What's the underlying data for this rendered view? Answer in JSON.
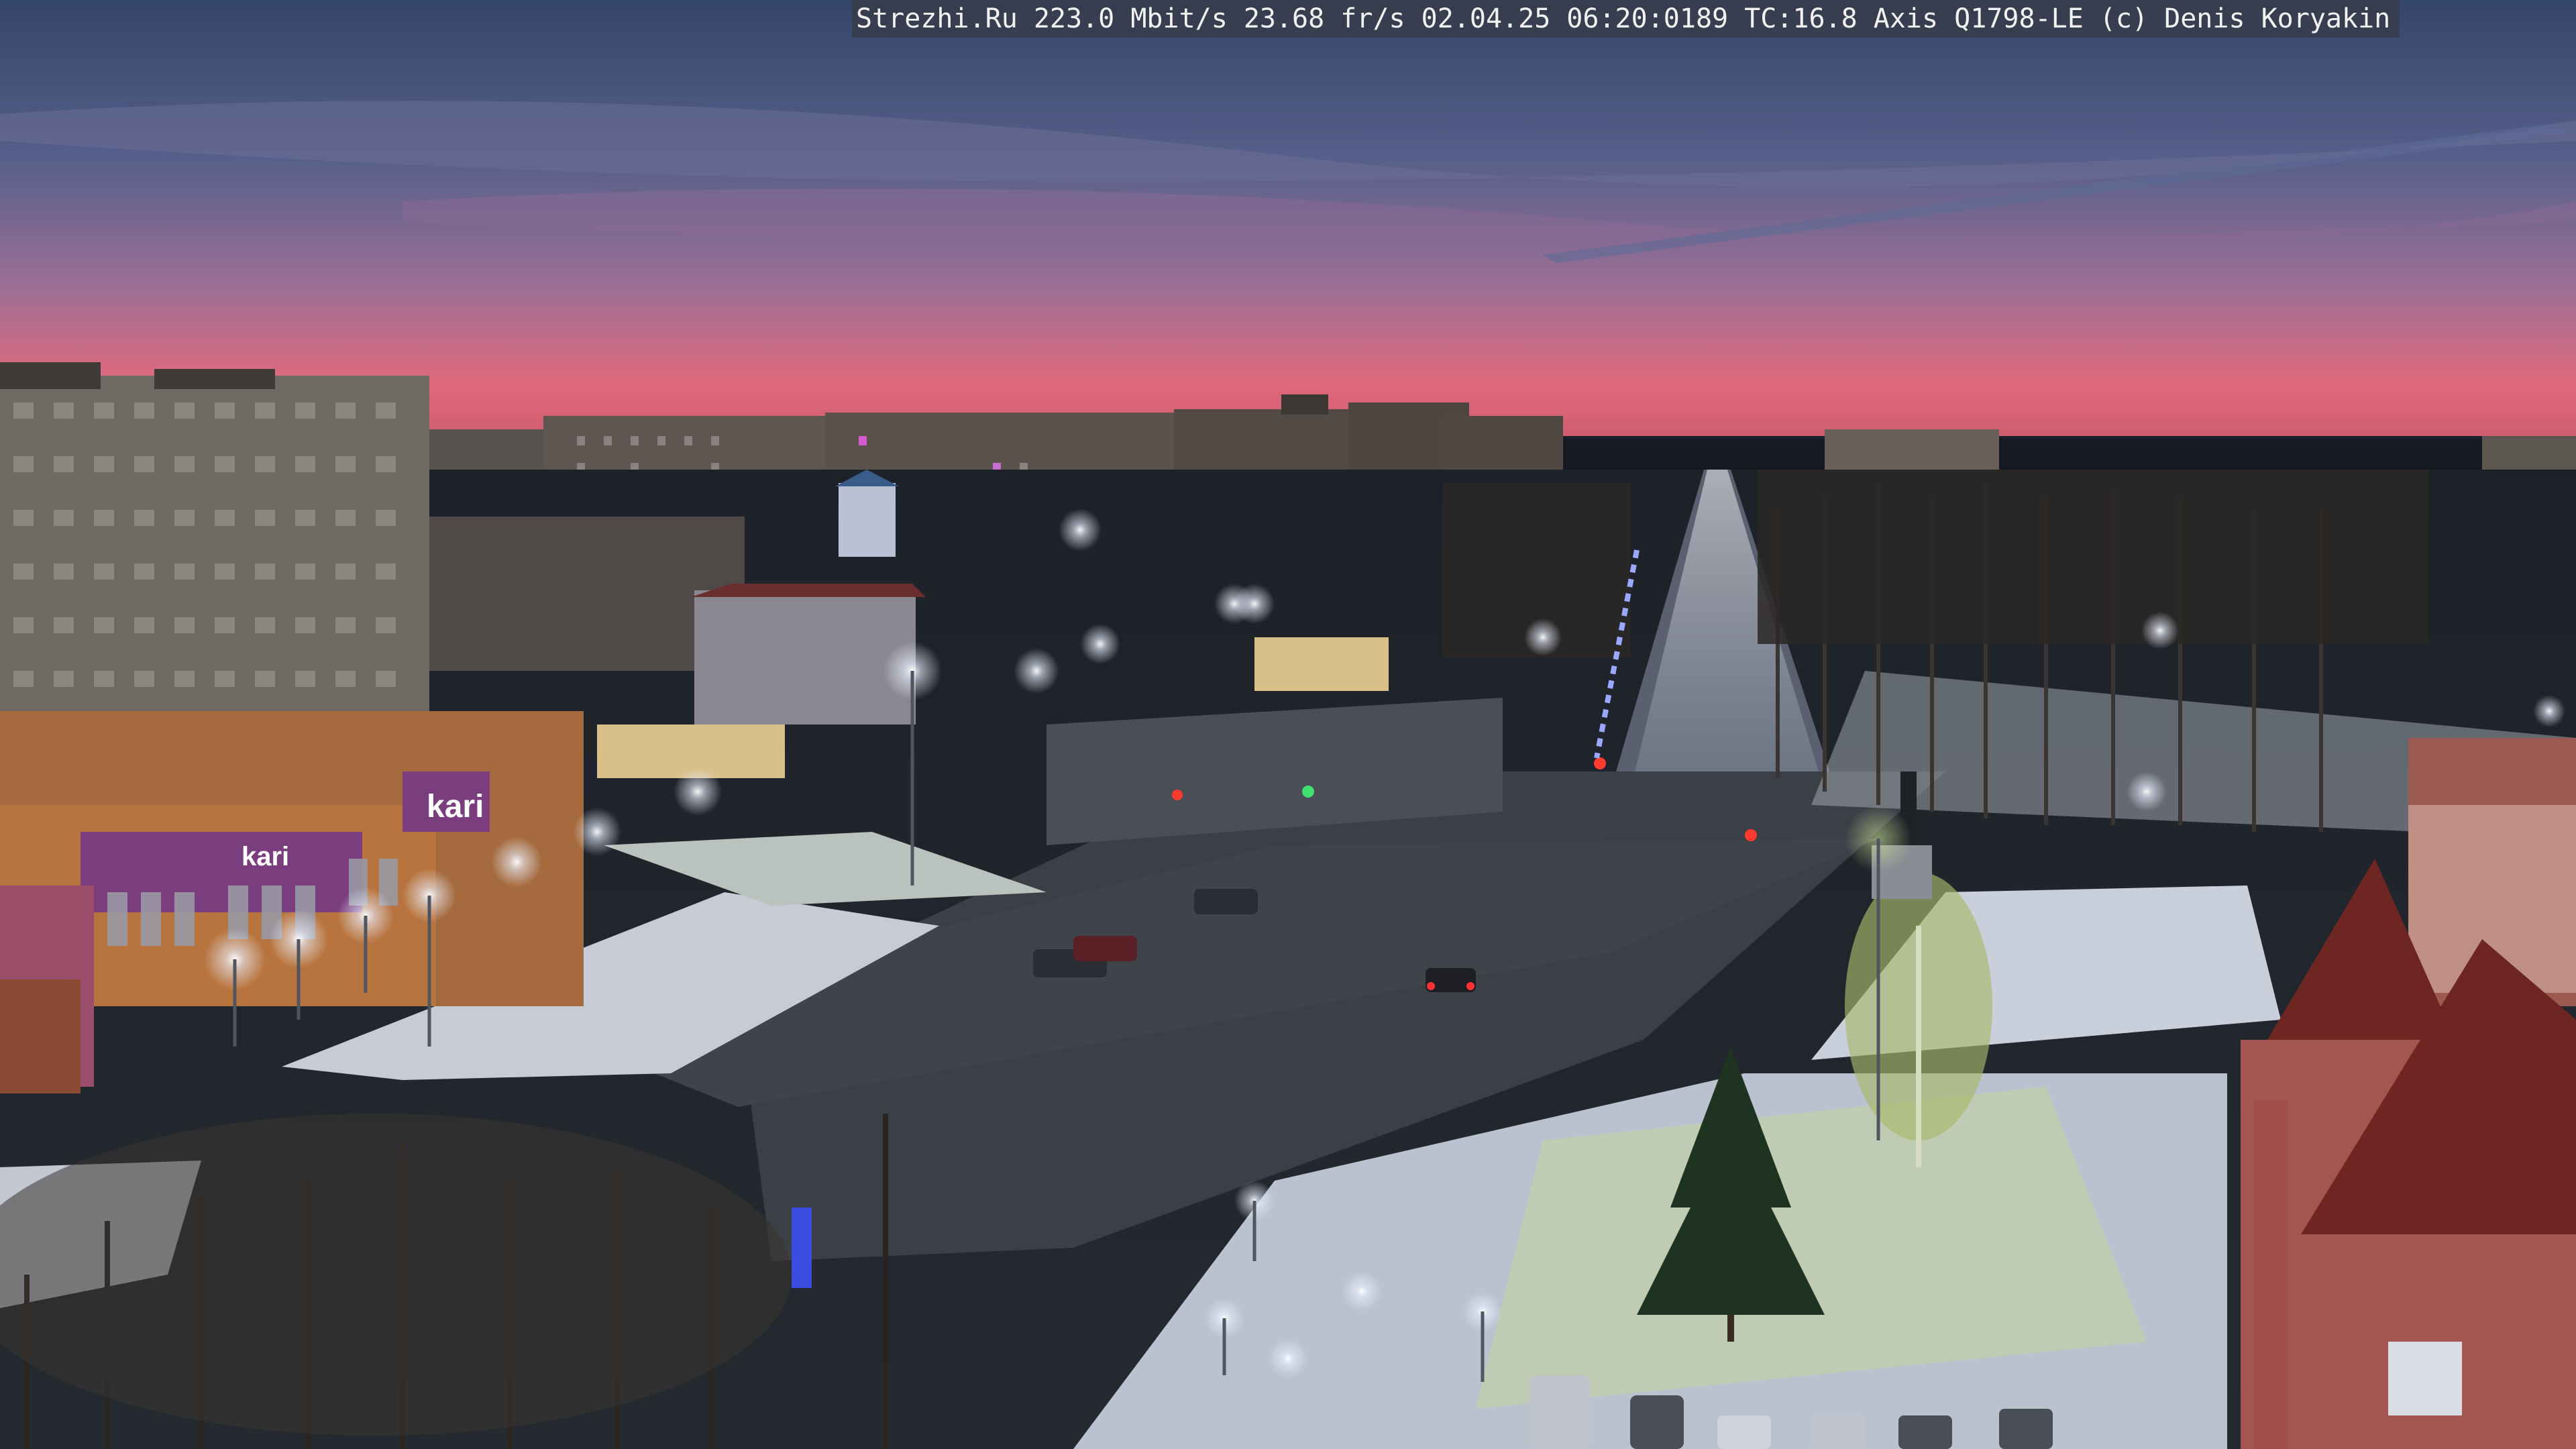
{
  "camera_overlay": {
    "site": "Strezhi.Ru",
    "bitrate": "223.0 Mbit/s",
    "fps": "23.68 fr/s",
    "date": "02.04.25",
    "time": "06:20:0189",
    "tc": "TC:16.8",
    "camera_model": "Axis Q1798-LE",
    "copyright": "(c) Denis Koryakin"
  },
  "signs": {
    "kari_small": "kari",
    "kari_large": "kari"
  },
  "colors": {
    "sky_top": "#3c4a70",
    "sky_mid": "#8a6f9a",
    "horizon_pink": "#e0667a",
    "snow": "#c9cfd8",
    "road": "#3d4148",
    "sign_purple": "#7a3d8e",
    "lamp": "#fff6d8"
  }
}
